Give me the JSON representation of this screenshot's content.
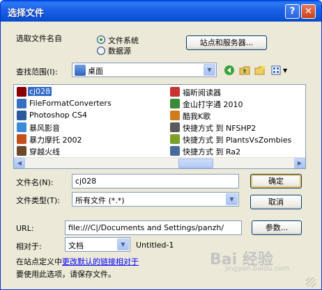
{
  "window": {
    "title": "选择文件",
    "help": "?",
    "close": "✕"
  },
  "select_name_from": {
    "label": "选取文件名自",
    "options": [
      {
        "label": "文件系统",
        "checked": true
      },
      {
        "label": "数据源",
        "checked": false
      }
    ]
  },
  "sites_button": "站点和服务器...",
  "look_in": {
    "label": "查找范围(I):",
    "value": "桌面"
  },
  "files": [
    {
      "name": "cj028",
      "icon": "swf-file-icon",
      "color": "#8A0000",
      "selected": true
    },
    {
      "name": "FileFormatConverters",
      "icon": "installer-icon",
      "color": "#3A6FC2"
    },
    {
      "name": "Photoshop CS4",
      "icon": "photoshop-icon",
      "color": "#2A5A9C"
    },
    {
      "name": "暴风影音",
      "icon": "media-player-icon",
      "color": "#3B8AD8"
    },
    {
      "name": "暴力摩托 2002",
      "icon": "game-icon",
      "color": "#C4501C"
    },
    {
      "name": "穿越火线",
      "icon": "game-icon",
      "color": "#6A4A2A"
    },
    {
      "name": "福昕阅读器",
      "icon": "pdf-reader-icon",
      "color": "#C83232"
    },
    {
      "name": "金山打字通 2010",
      "icon": "typing-app-icon",
      "color": "#3A8A3A"
    },
    {
      "name": "酷我K歌",
      "icon": "karaoke-icon",
      "color": "#D07A1A"
    },
    {
      "name": "快捷方式 到 NFSHP2",
      "icon": "shortcut-icon",
      "color": "#5A5A5A"
    },
    {
      "name": "快捷方式 到 PlantsVsZombies",
      "icon": "shortcut-icon",
      "color": "#7AA02A"
    },
    {
      "name": "快捷方式 到 Ra2",
      "icon": "shortcut-icon",
      "color": "#4A6A9A"
    }
  ],
  "file_name": {
    "label": "文件名(N):",
    "value": "cj028"
  },
  "file_type": {
    "label": "文件类型(T):",
    "value": "所有文件 (*.*)"
  },
  "ok_button": "确定",
  "cancel_button": "取消",
  "url": {
    "label": "URL:",
    "value": "file:///C|/Documents and Settings/panzh/"
  },
  "params_button": "参数...",
  "relative_to": {
    "label": "相对于:",
    "value": "文档",
    "doc": "Untitled-1"
  },
  "site_define": {
    "prefix": "在站点定义中",
    "link": "更改默认的链接相对于"
  },
  "save_note": "要使用此选项，请保存文件。",
  "watermark": {
    "big": "Bai 经验",
    "small": "jingyan.baidu.com"
  }
}
